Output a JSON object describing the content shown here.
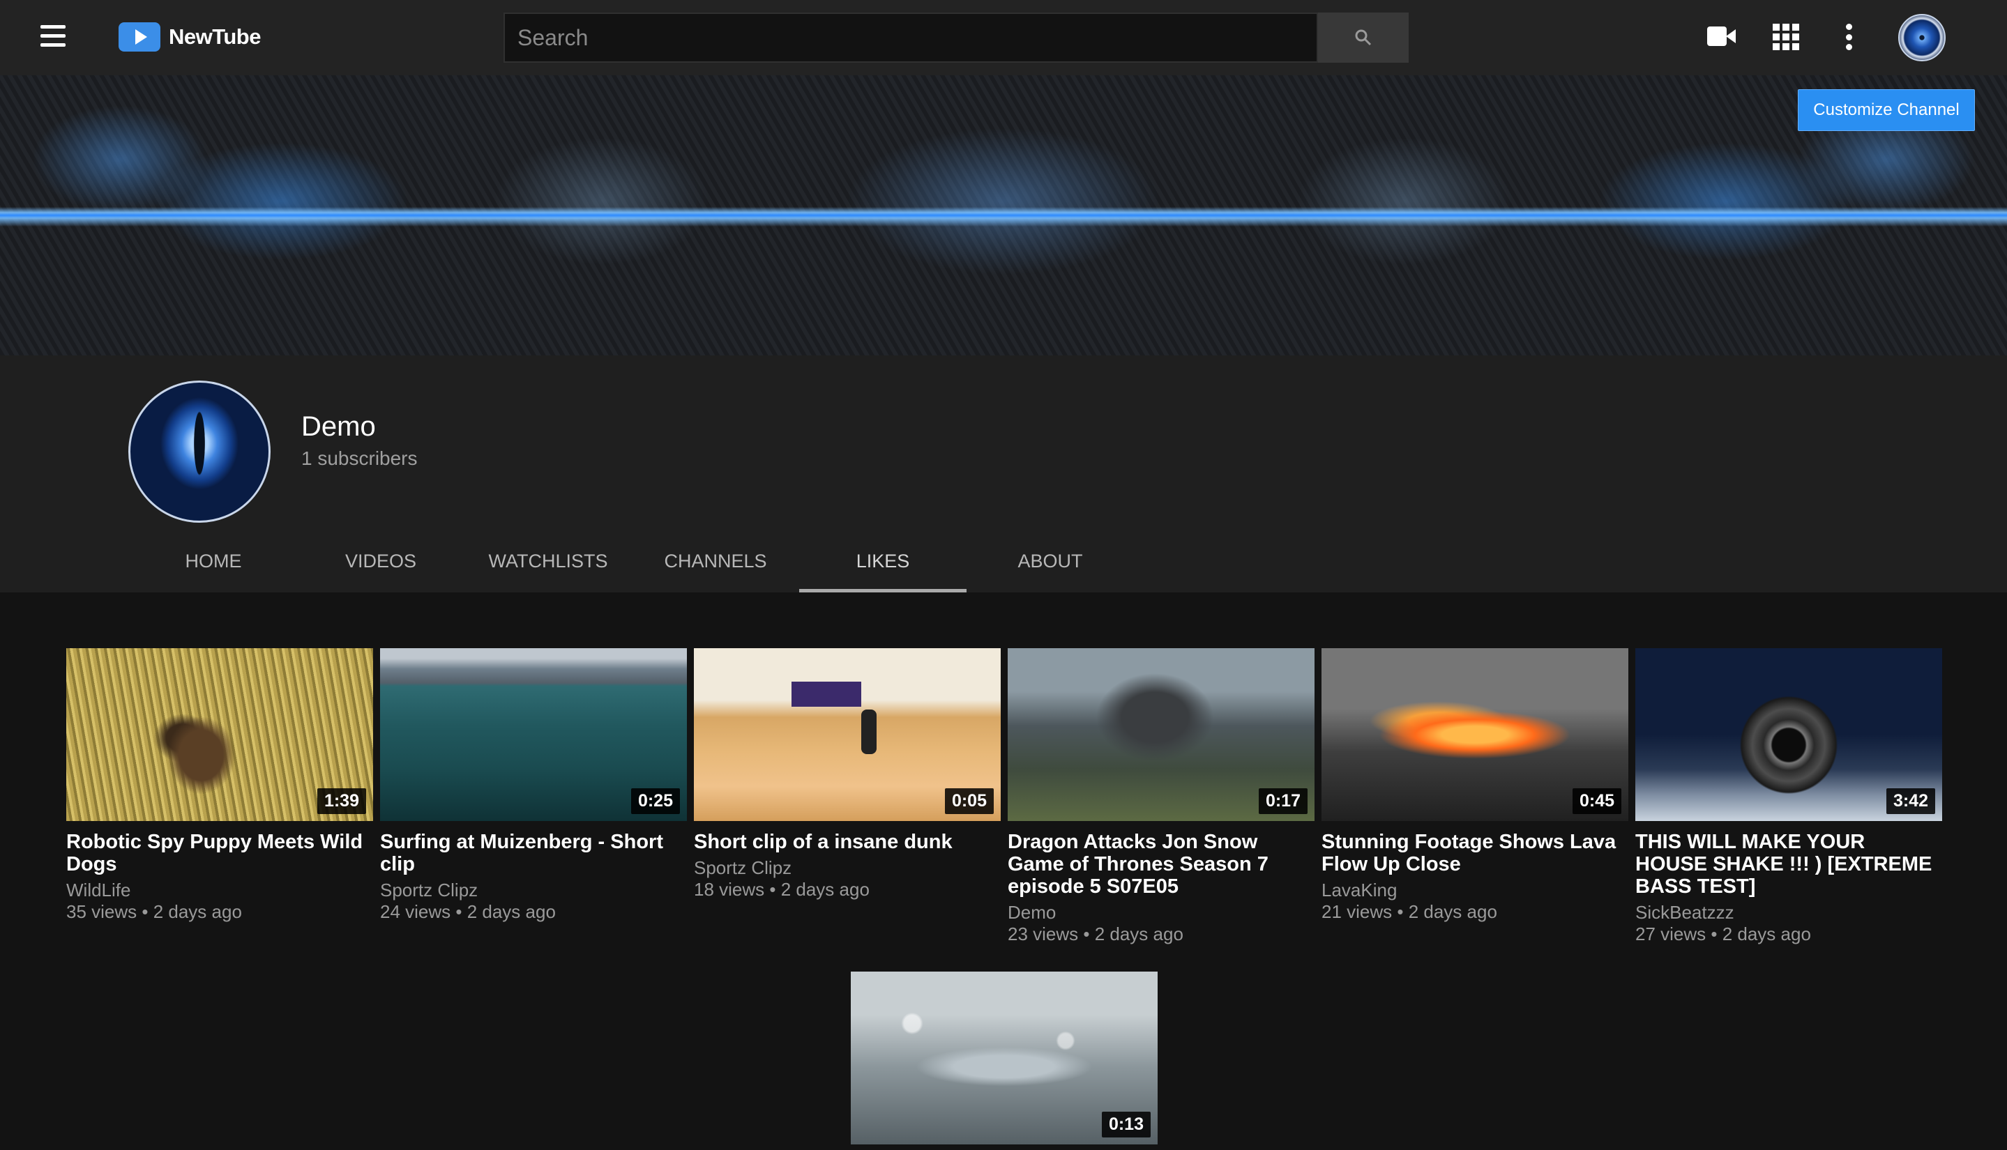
{
  "app": {
    "name": "NewTube"
  },
  "search": {
    "placeholder": "Search",
    "value": ""
  },
  "topbar": {
    "icons": [
      "menu-icon",
      "video-camera-icon",
      "apps-grid-icon",
      "more-vert-icon",
      "user-avatar"
    ]
  },
  "banner": {
    "customize_label": "Customize Channel",
    "accent": "#2a8ff2"
  },
  "channel": {
    "name": "Demo",
    "subscribers": "1 subscribers"
  },
  "tabs": [
    {
      "label": "HOME",
      "active": false
    },
    {
      "label": "VIDEOS",
      "active": false
    },
    {
      "label": "WATCHLISTS",
      "active": false
    },
    {
      "label": "CHANNELS",
      "active": false
    },
    {
      "label": "LIKES",
      "active": true
    },
    {
      "label": "ABOUT",
      "active": false
    }
  ],
  "videos": [
    {
      "title": "Robotic Spy Puppy Meets Wild Dogs",
      "channel": "WildLife",
      "meta": "35 views • 2 days ago",
      "duration": "1:39"
    },
    {
      "title": "Surfing at Muizenberg - Short clip",
      "channel": "Sportz Clipz",
      "meta": "24 views • 2 days ago",
      "duration": "0:25"
    },
    {
      "title": "Short clip of a insane dunk",
      "channel": "Sportz Clipz",
      "meta": "18 views • 2 days ago",
      "duration": "0:05"
    },
    {
      "title": "Dragon Attacks Jon Snow Game of Thrones Season 7 episode 5 S07E05",
      "channel": "Demo",
      "meta": "23 views • 2 days ago",
      "duration": "0:17"
    },
    {
      "title": "Stunning Footage Shows Lava Flow Up Close",
      "channel": "LavaKing",
      "meta": "21 views • 2 days ago",
      "duration": "0:45"
    },
    {
      "title": "THIS WILL MAKE YOUR HOUSE SHAKE !!! ) [EXTREME BASS TEST]",
      "channel": "SickBeatzzz",
      "meta": "27 views • 2 days ago",
      "duration": "3:42"
    },
    {
      "title": "",
      "channel": "",
      "meta": "",
      "duration": "0:13"
    }
  ]
}
